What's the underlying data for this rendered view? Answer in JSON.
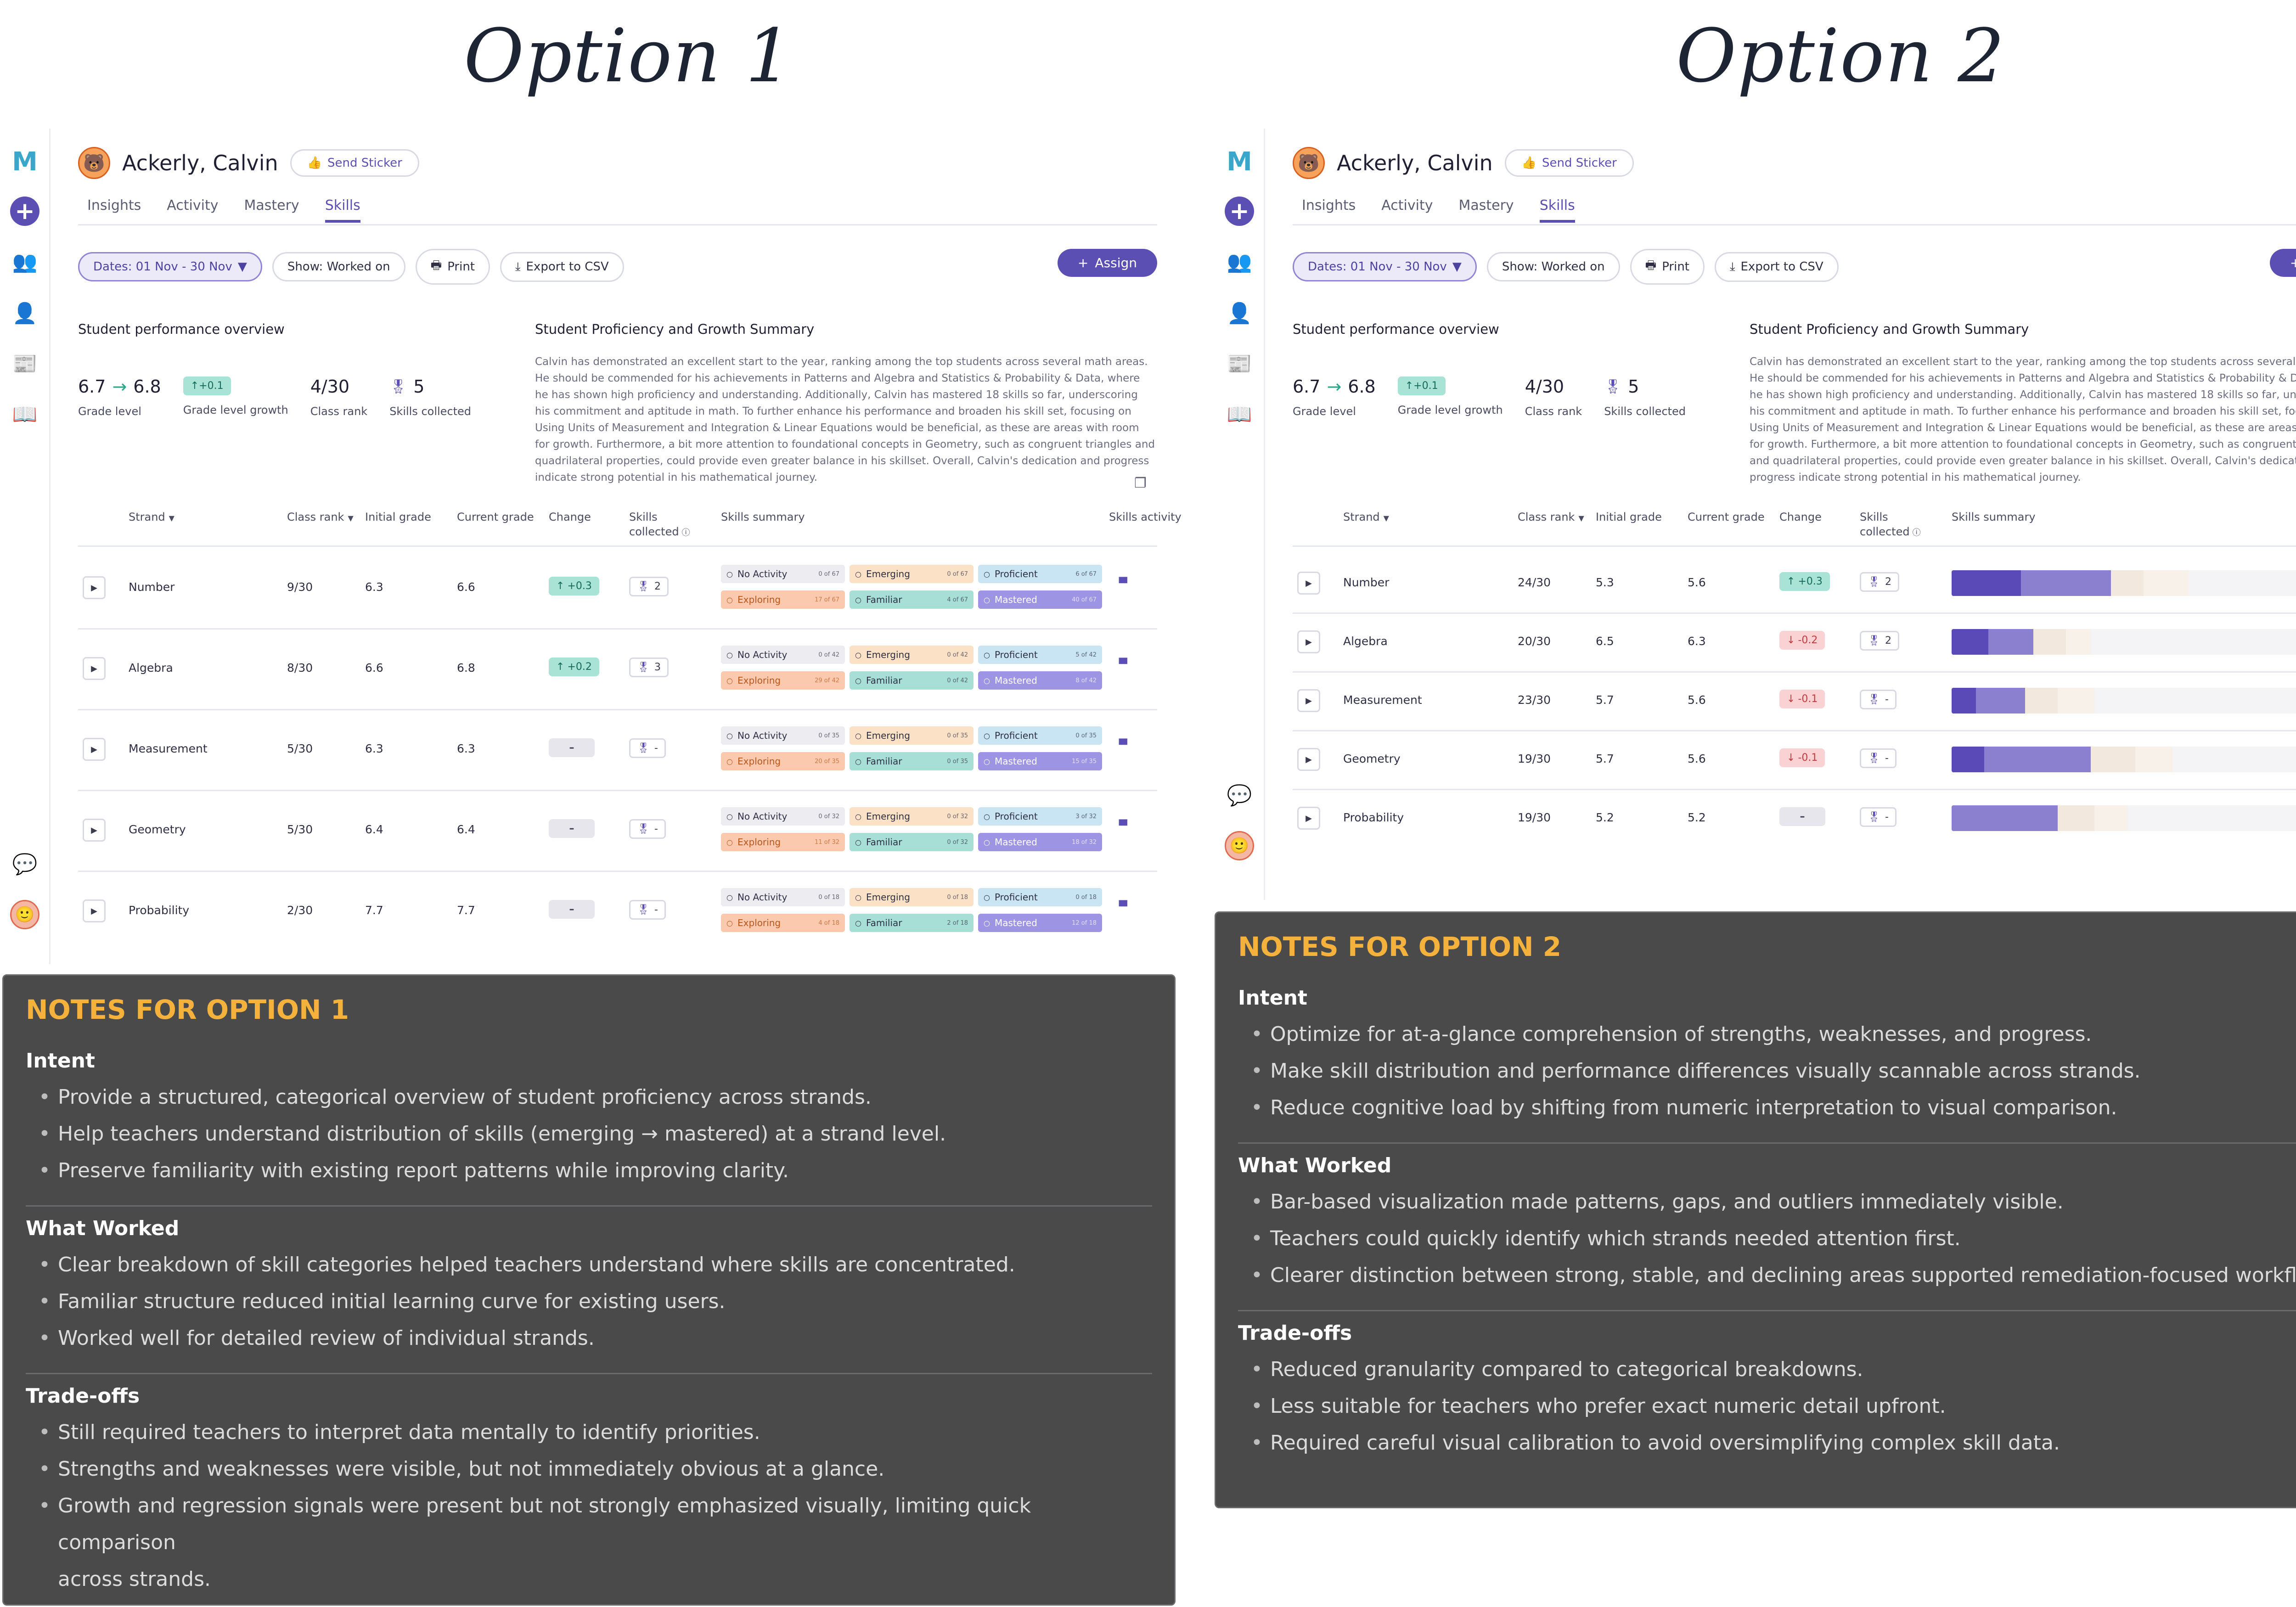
{
  "option_titles": [
    "Option 1",
    "Option 2"
  ],
  "student": {
    "name": "Ackerly, Calvin",
    "sticker_label": "Send Sticker"
  },
  "tabs": [
    "Insights",
    "Activity",
    "Mastery",
    "Skills"
  ],
  "toolbar": {
    "dates": "Dates: 01 Nov - 30 Nov",
    "show": "Show: Worked on",
    "print": "Print",
    "export": "Export to CSV",
    "assign": "Assign"
  },
  "overview": {
    "title": "Student performance overview",
    "grade_from": "6.7",
    "grade_to": "6.8",
    "grade_label": "Grade level",
    "growth": "+0.1",
    "growth_label": "Grade level growth",
    "rank": "4/30",
    "rank_label": "Class rank",
    "skills": "5",
    "skills_label": "Skills collected"
  },
  "summary": {
    "title": "Student Proficiency and Growth Summary",
    "text": "Calvin has demonstrated an excellent start to the year, ranking among the top students across several math areas. He should be commended for his achievements in Patterns and Algebra and Statistics & Probability & Data, where he has shown high proficiency and understanding. Additionally, Calvin has mastered 18 skills so far, underscoring his commitment and aptitude in math. To further enhance his performance and broaden his skill set, focusing on Using Units of Measurement and Integration & Linear Equations would be beneficial, as these are areas with room for growth. Furthermore, a bit more attention to foundational concepts in Geometry, such as congruent triangles and quadrilateral properties, could provide even greater balance in his skillset. Overall, Calvin's dedication and progress indicate strong potential in his mathematical journey."
  },
  "table_headers": {
    "strand": "Strand",
    "class_rank": "Class rank",
    "initial": "Initial grade",
    "current": "Current grade",
    "change": "Change",
    "skills": "Skills collected",
    "summary": "Skills summary",
    "activity": "Skills activity"
  },
  "skill_labels": {
    "na": "No Activity",
    "em": "Emerging",
    "pr": "Proficient",
    "ex": "Exploring",
    "fa": "Familiar",
    "ma": "Mastered"
  },
  "option1_rows": [
    {
      "strand": "Number",
      "rank": "9/30",
      "initial": "6.3",
      "current": "6.6",
      "change": "+0.3",
      "dir": "up",
      "skills": "2",
      "counts": {
        "na": "0 of 67",
        "em": "0 of 67",
        "pr": "6 of 67",
        "ex": "17 of 67",
        "fa": "4 of 67",
        "ma": "40 of 67"
      }
    },
    {
      "strand": "Algebra",
      "rank": "8/30",
      "initial": "6.6",
      "current": "6.8",
      "change": "+0.2",
      "dir": "up",
      "skills": "3",
      "counts": {
        "na": "0 of 42",
        "em": "0 of 42",
        "pr": "5 of 42",
        "ex": "29 of 42",
        "fa": "0 of 42",
        "ma": "8 of 42"
      }
    },
    {
      "strand": "Measurement",
      "rank": "5/30",
      "initial": "6.3",
      "current": "6.3",
      "change": "–",
      "dir": "nil",
      "skills": "-",
      "counts": {
        "na": "0 of 35",
        "em": "0 of 35",
        "pr": "0 of 35",
        "ex": "20 of 35",
        "fa": "0 of 35",
        "ma": "15 of 35"
      }
    },
    {
      "strand": "Geometry",
      "rank": "5/30",
      "initial": "6.4",
      "current": "6.4",
      "change": "–",
      "dir": "nil",
      "skills": "-",
      "counts": {
        "na": "0 of 32",
        "em": "0 of 32",
        "pr": "3 of 32",
        "ex": "11 of 32",
        "fa": "0 of 32",
        "ma": "18 of 32"
      }
    },
    {
      "strand": "Probability",
      "rank": "2/30",
      "initial": "7.7",
      "current": "7.7",
      "change": "–",
      "dir": "nil",
      "skills": "-",
      "counts": {
        "na": "0 of 18",
        "em": "0 of 18",
        "pr": "0 of 18",
        "ex": "4 of 18",
        "fa": "2 of 18",
        "ma": "12 of 18"
      }
    }
  ],
  "option2_rows": [
    {
      "strand": "Number",
      "rank": "24/30",
      "initial": "5.3",
      "current": "5.6",
      "change": "+0.3",
      "dir": "up",
      "skills": "2",
      "bar": [
        0.17,
        0.22,
        0.08,
        0.11,
        0.31,
        0.11
      ]
    },
    {
      "strand": "Algebra",
      "rank": "20/30",
      "initial": "6.5",
      "current": "6.3",
      "change": "-0.2",
      "dir": "dn",
      "skills": "2",
      "bar": [
        0.09,
        0.11,
        0.08,
        0.06,
        0.57,
        0.09
      ]
    },
    {
      "strand": "Measurement",
      "rank": "23/30",
      "initial": "5.7",
      "current": "5.6",
      "change": "-0.1",
      "dir": "dn",
      "skills": "-",
      "bar": [
        0.06,
        0.12,
        0.08,
        0.09,
        0.65,
        0.0
      ]
    },
    {
      "strand": "Geometry",
      "rank": "19/30",
      "initial": "5.7",
      "current": "5.6",
      "change": "-0.1",
      "dir": "dn",
      "skills": "-",
      "bar": [
        0.08,
        0.26,
        0.11,
        0.09,
        0.46,
        0.0
      ]
    },
    {
      "strand": "Probability",
      "rank": "19/30",
      "initial": "5.2",
      "current": "5.2",
      "change": "–",
      "dir": "nil",
      "skills": "-",
      "bar": [
        0.0,
        0.26,
        0.09,
        0.08,
        0.57,
        0.0
      ]
    }
  ],
  "bar_colors": [
    "#5a4ab8",
    "#8a80cf",
    "#f2e8dd",
    "#f7f1ea",
    "#f4f4f6",
    "#e7e7ea"
  ],
  "notes1": {
    "title": "NOTES FOR OPTION 1",
    "sections": [
      {
        "heading": "Intent",
        "items": [
          "Provide a structured, categorical overview of student proficiency across strands.",
          "Help teachers understand distribution of skills (emerging → mastered) at a strand level.",
          "Preserve familiarity with existing report patterns while improving clarity."
        ]
      },
      {
        "heading": "What Worked",
        "items": [
          "Clear breakdown of skill categories helped teachers understand where skills are concentrated.",
          "Familiar structure reduced initial learning curve for existing users.",
          "Worked well for detailed review of individual strands."
        ]
      },
      {
        "heading": "Trade-offs",
        "items": [
          "Still required teachers to interpret data mentally to identify priorities.",
          "Strengths and weaknesses were visible, but not immediately obvious at a glance.",
          "Growth and regression signals were present but not strongly emphasized visually, limiting quick comparison",
          "across strands."
        ]
      }
    ]
  },
  "notes2": {
    "title": "NOTES FOR OPTION 2",
    "sections": [
      {
        "heading": "Intent",
        "items": [
          "Optimize for at-a-glance comprehension of strengths, weaknesses, and progress.",
          "Make skill distribution and performance differences visually scannable across strands.",
          "Reduce cognitive load by shifting from numeric interpretation to visual comparison."
        ]
      },
      {
        "heading": "What Worked",
        "items": [
          "Bar-based visualization made patterns, gaps, and outliers immediately visible.",
          "Teachers could quickly identify which strands needed attention first.",
          "Clearer distinction between strong, stable, and declining areas supported remediation-focused workflows."
        ]
      },
      {
        "heading": "Trade-offs",
        "items": [
          "Reduced granularity compared to categorical breakdowns.",
          "Less suitable for teachers who prefer exact numeric detail upfront.",
          "Required careful visual calibration to avoid oversimplifying complex skill data."
        ]
      }
    ]
  },
  "icons": {
    "logo": "logo-icon",
    "plus": "plus-icon",
    "classes": "group-icon",
    "students": "person-icon",
    "reports": "report-icon",
    "library": "book-icon",
    "help": "chat-icon"
  }
}
